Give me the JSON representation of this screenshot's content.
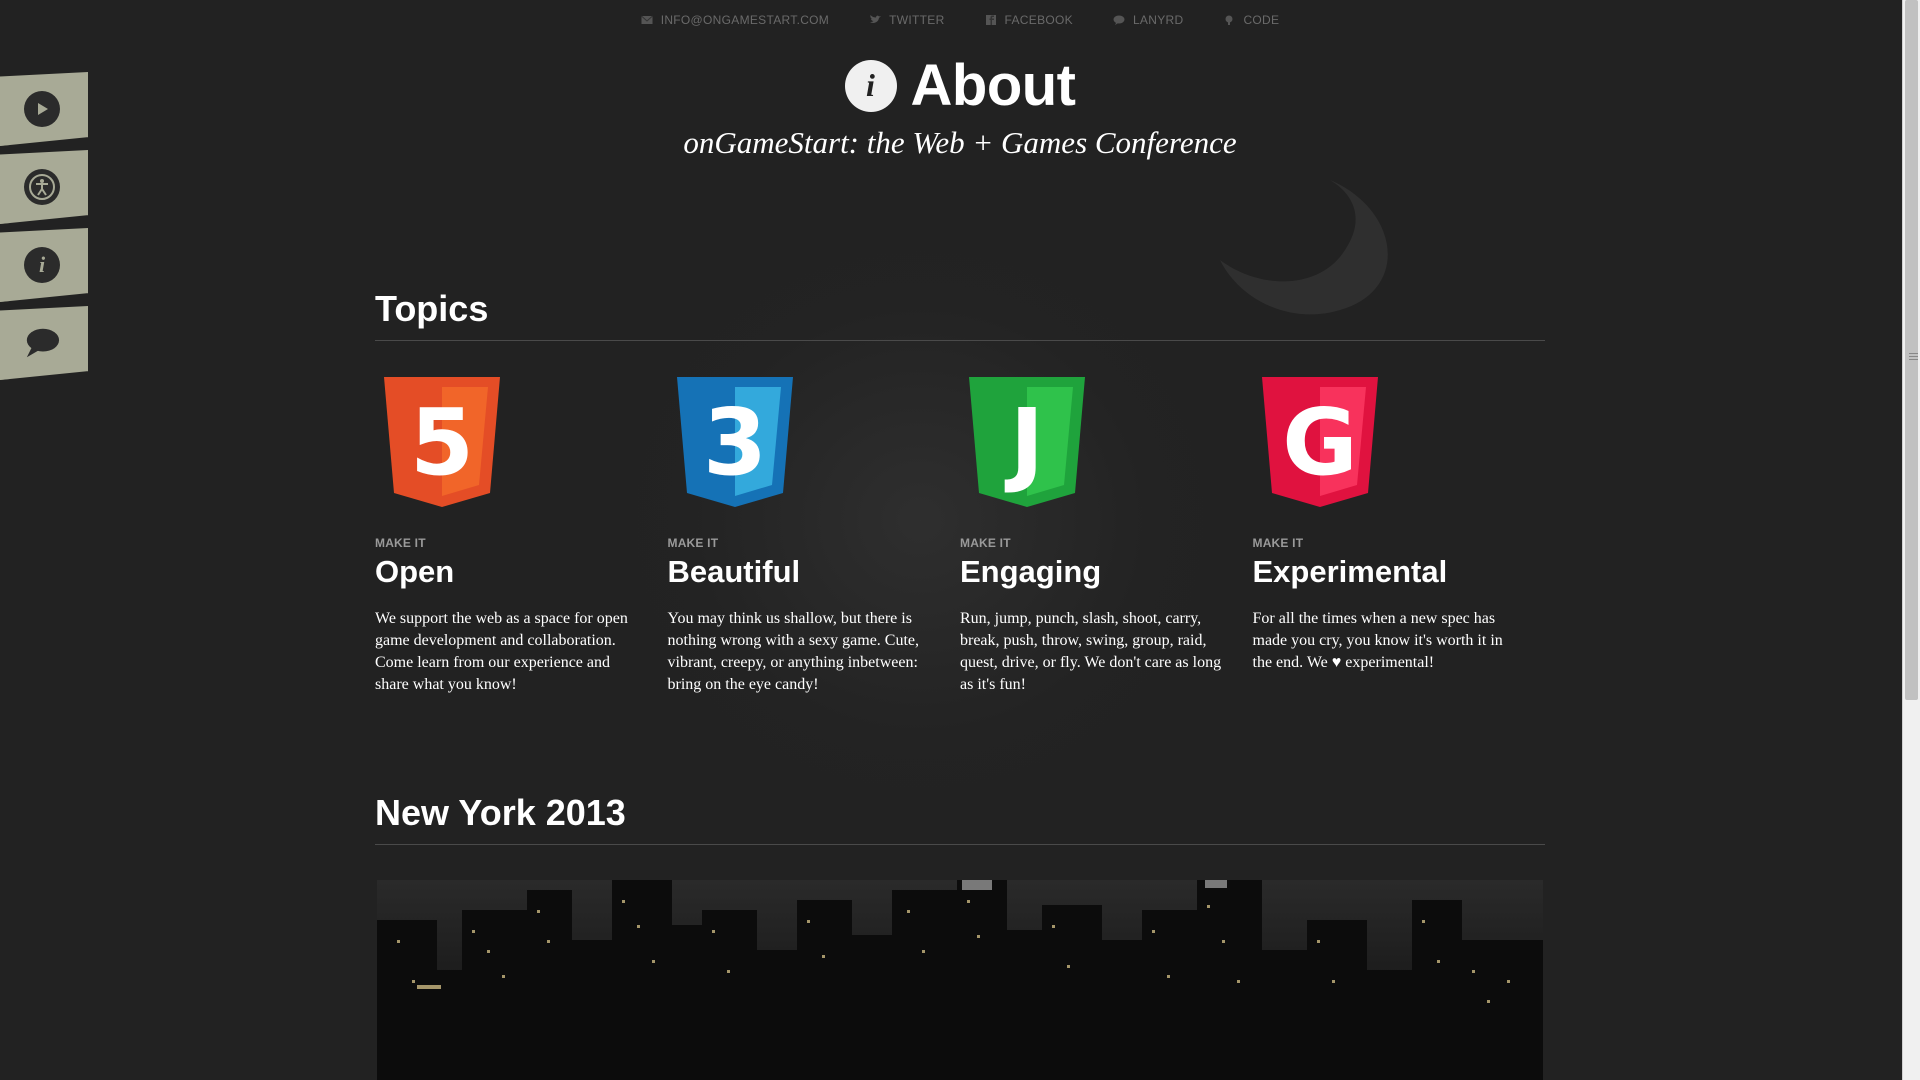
{
  "top_links": [
    {
      "label": "INFO@ONGAMESTART.COM",
      "icon": "mail-icon"
    },
    {
      "label": "TWITTER",
      "icon": "twitter-icon"
    },
    {
      "label": "FACEBOOK",
      "icon": "facebook-icon"
    },
    {
      "label": "LANYRD",
      "icon": "lanyrd-icon"
    },
    {
      "label": "CODE",
      "icon": "code-icon"
    }
  ],
  "sidenav": [
    {
      "icon": "play-icon"
    },
    {
      "icon": "accessibility-icon"
    },
    {
      "icon": "info-icon"
    },
    {
      "icon": "speech-bubble-icon"
    }
  ],
  "header": {
    "badge": "i",
    "title": "About",
    "subtitle": "onGameStart: the Web + Games Conference"
  },
  "topics": {
    "heading": "Topics",
    "items": [
      {
        "badge_letter": "5",
        "color": "#e44d26",
        "color_light": "#f16529",
        "kicker": "MAKE IT",
        "title": "Open",
        "text": "We support the web as a space for open game development and collaboration. Come learn from our experience and share what you know!"
      },
      {
        "badge_letter": "3",
        "color": "#1572b6",
        "color_light": "#33a9dc",
        "kicker": "MAKE IT",
        "title": "Beautiful",
        "text": "You may think us shallow, but there is nothing wrong with a sexy game. Cute, vibrant, creepy, or anything inbetween: bring on the eye candy!"
      },
      {
        "badge_letter": "J",
        "color": "#1fa33c",
        "color_light": "#2fc24b",
        "kicker": "MAKE IT",
        "title": "Engaging",
        "text": "Run, jump, punch, slash, shoot, carry, break, push, throw, swing, group, raid, quest, drive, or fly. We don't care as long as it's fun!"
      },
      {
        "badge_letter": "G",
        "color": "#e0123f",
        "color_light": "#f8325c",
        "kicker": "MAKE IT",
        "title": "Experimental",
        "text": "For all the times when a new spec has made you cry, you know it's worth it in the end. We ♥ experimental!"
      }
    ]
  },
  "newyork": {
    "heading": "New York 2013"
  },
  "colors": {
    "background": "#222222",
    "sidenav_tab": "#a8aa96",
    "link_text": "#6a6a6a"
  }
}
